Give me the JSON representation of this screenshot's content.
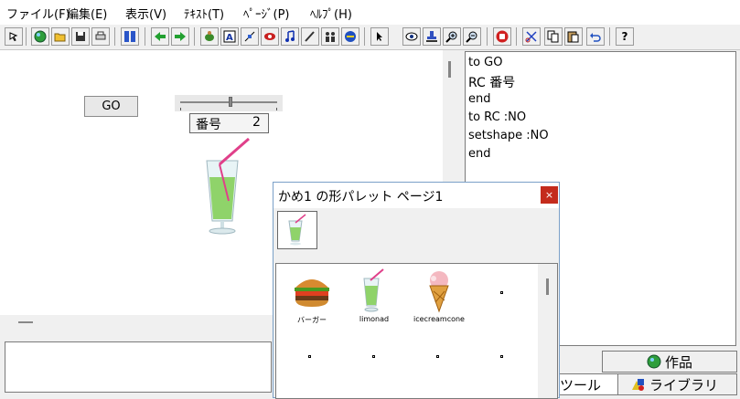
{
  "menu": {
    "items": [
      "ファイル(F)",
      "編集(E)",
      "表示(V)",
      "ﾃｷｽﾄ(T)",
      "ﾍﾟｰｼﾞ(P)",
      "ﾍﾙﾌﾟ(H)"
    ]
  },
  "toolbar": {
    "icons": [
      "pointer-icon",
      "globe-icon",
      "open-folder-icon",
      "save-icon",
      "print-icon",
      "columns-icon",
      "arrow-left-icon",
      "arrow-right-icon",
      "turtle-icon",
      "text-box-icon",
      "slider-icon",
      "eye-button-icon",
      "music-icon",
      "pen-icon",
      "people-icon",
      "globe-run-icon",
      "select-arrow-icon",
      "eye-icon",
      "stamp-icon",
      "zoom-in-icon",
      "zoom-out-icon",
      "stop-hand-icon",
      "scissors-icon",
      "copy-icon",
      "paste-icon",
      "undo-icon"
    ],
    "help_label": "?"
  },
  "canvas": {
    "go_button_label": "GO",
    "monitor_label": "番号",
    "monitor_value": "2"
  },
  "editor": {
    "lines": [
      "to GO",
      "RC 番号",
      "end",
      "to RC :NO",
      "setshape :NO",
      "end"
    ]
  },
  "tabs": {
    "works": "作品",
    "tool": "ツール",
    "library": "ライブラリ"
  },
  "palette": {
    "title": "かめ1 の形パレット ページ1",
    "close": "×",
    "shapes": [
      "バーガー",
      "limonad",
      "icecreamcone"
    ]
  },
  "colors": {
    "close_button": "#c42b1c",
    "drink_green": "#8fd36a",
    "straw_pink": "#e0408a"
  }
}
